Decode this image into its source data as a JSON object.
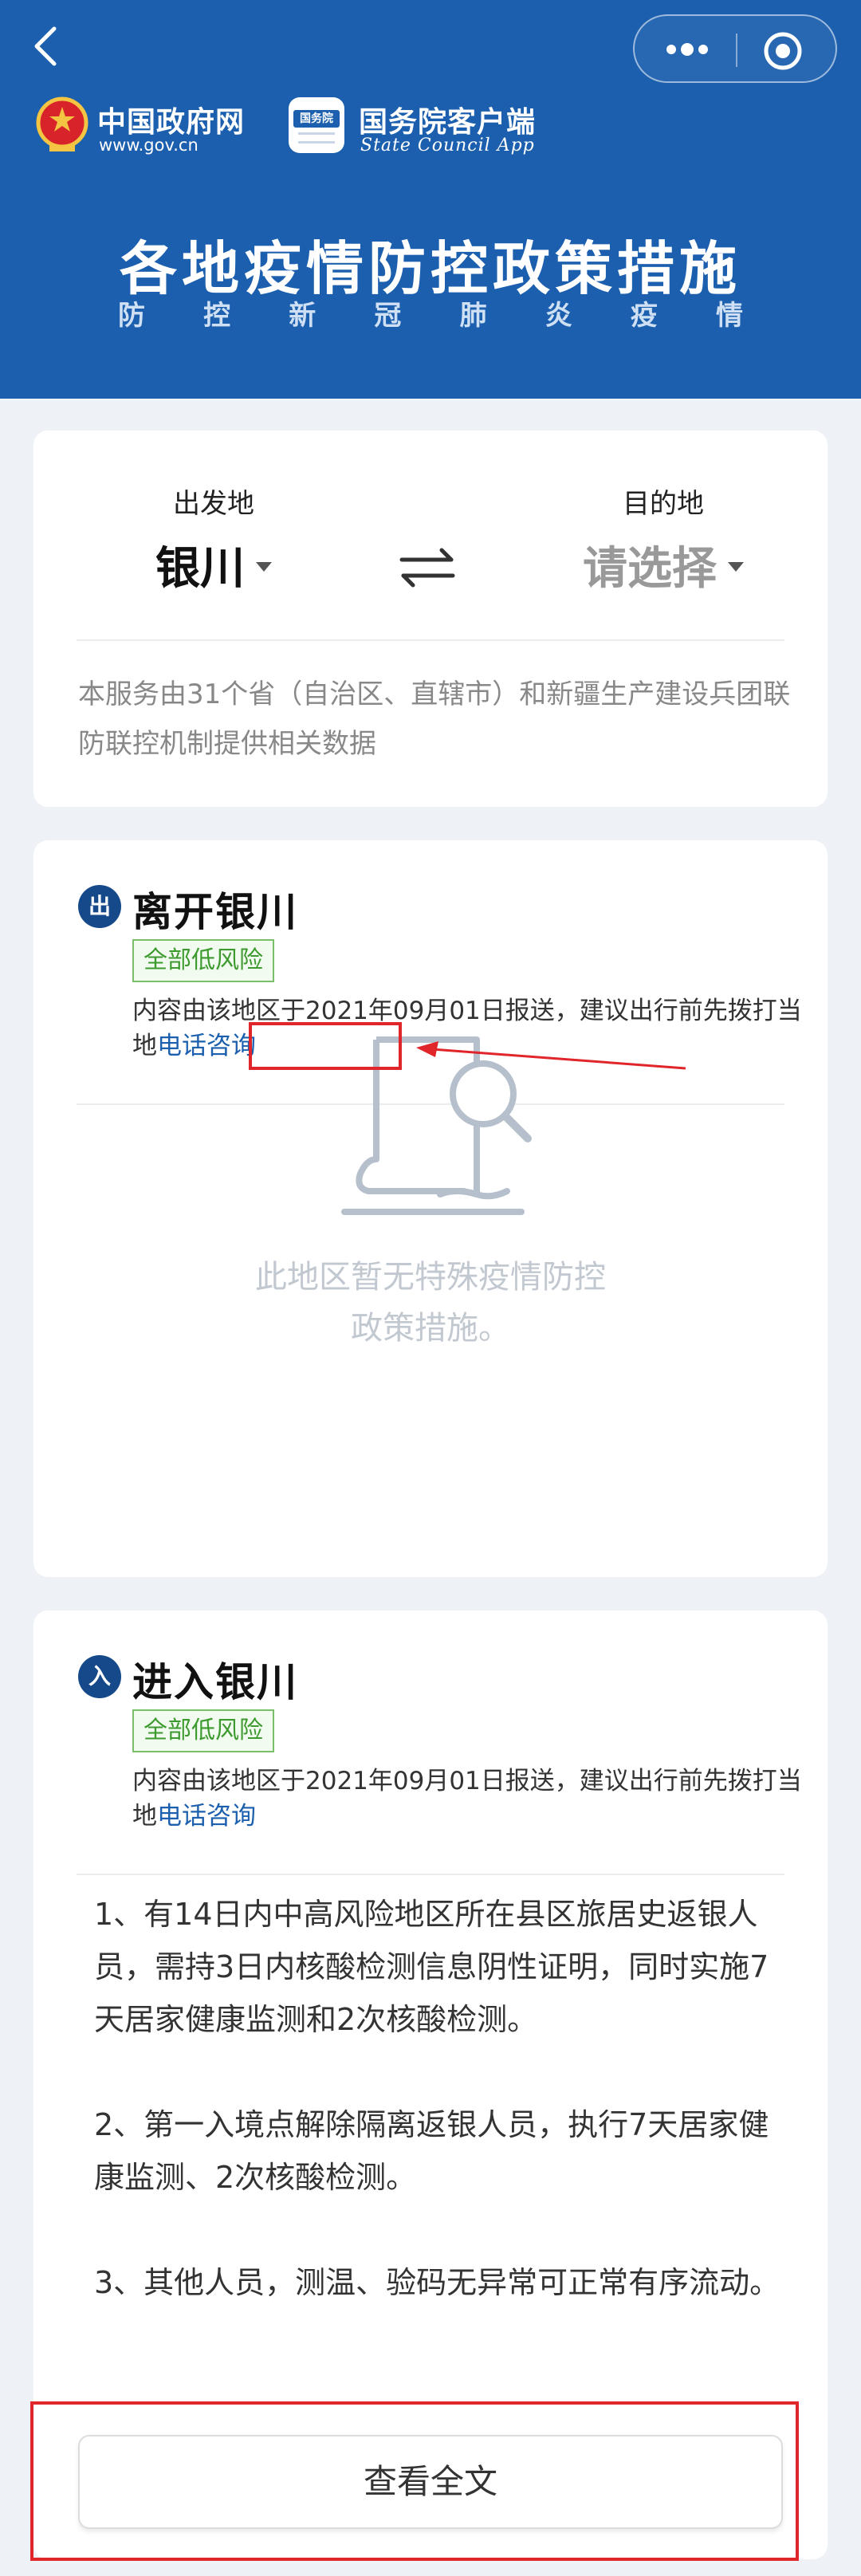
{
  "header": {
    "gov_name": "中国政府网",
    "gov_url": "www.gov.cn",
    "sc_badge": "国务院",
    "sc_name": "国务院客户端",
    "sc_sub": "State Council App",
    "title": "各地疫情防控政策措施",
    "subtitle_chars": [
      "防",
      "控",
      "新",
      "冠",
      "肺",
      "炎",
      "疫",
      "情"
    ]
  },
  "route": {
    "from_label": "出发地",
    "from_value": "银川",
    "to_label": "目的地",
    "to_value": "请选择",
    "note": "本服务由31个省（自治区、直辖市）和新疆生产建设兵团联防联控机制提供相关数据"
  },
  "leave": {
    "badge": "出",
    "title": "离开银川",
    "risk": "全部低风险",
    "report_prefix": "内容由该地区于2021年09月01日报送，建议出行前先拨打当地",
    "report_link": "电话咨询",
    "empty_line1": "此地区暂无特殊疫情防控",
    "empty_line2": "政策措施。"
  },
  "enter": {
    "badge": "入",
    "title": "进入银川",
    "risk": "全部低风险",
    "report_prefix": "内容由该地区于2021年09月01日报送，建议出行前先拨打当地",
    "report_link": "电话咨询",
    "policies": "1、有14日内中高风险地区所在县区旅居史返银人员，需持3日内核酸检测信息阴性证明，同时实施7天居家健康监测和2次核酸检测。\n\n2、第一入境点解除隔离返银人员，执行7天居家健康监测、2次核酸检测。\n\n3、其他人员，测温、验码无异常可正常有序流动。",
    "view_all": "查看全文"
  },
  "colors": {
    "header_blue": "#1b5fae",
    "badge_blue": "#16498a",
    "risk_green": "#3c9a2e",
    "annotation_red": "#e0262b"
  }
}
